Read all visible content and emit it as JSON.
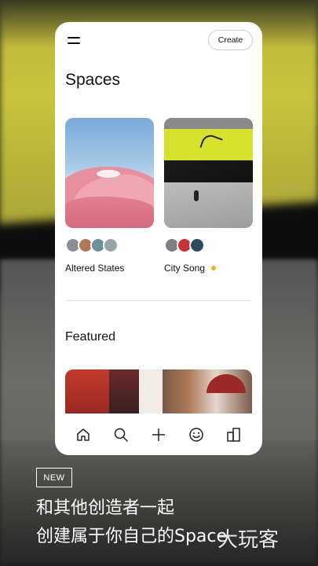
{
  "header": {
    "create_label": "Create"
  },
  "page": {
    "title": "Spaces"
  },
  "spaces": [
    {
      "name": "Altered States",
      "avatar_colors": [
        "#8a8e92",
        "#b07a58",
        "#6f8f9a",
        "#9aa3aa"
      ],
      "status_dot_color": null
    },
    {
      "name": "City Song",
      "avatar_colors": [
        "#7d7f85",
        "#c8323a",
        "#2f4a5c"
      ],
      "status_dot_color": "#e2b928"
    }
  ],
  "featured": {
    "title": "Featured"
  },
  "tabbar": {
    "items": [
      "home-icon",
      "search-icon",
      "plus-icon",
      "smiley-icon",
      "library-icon"
    ]
  },
  "promo": {
    "badge": "NEW",
    "line1": "和其他创造者一起",
    "line2": "创建属于你自己的Space",
    "watermark": "大玩客"
  }
}
